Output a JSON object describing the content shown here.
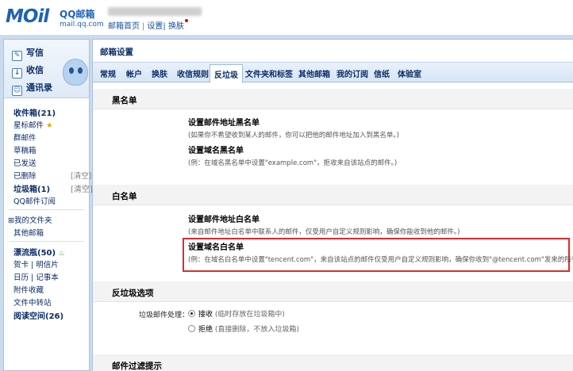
{
  "header": {
    "logo_mark": "MOil",
    "logo_qq": "QQ邮箱",
    "logo_domain": "mail.qq.com",
    "links": [
      "邮箱首页",
      "设置",
      "换肤"
    ],
    "link_sep": "|"
  },
  "sidebar": {
    "actions": [
      {
        "label": "写信",
        "icon": "pencil-icon"
      },
      {
        "label": "收信",
        "icon": "inbox-download-icon"
      },
      {
        "label": "通讯录",
        "icon": "contacts-icon"
      }
    ],
    "folders": {
      "inbox": "收件箱(21)",
      "starred": "星标邮件",
      "groups": "群邮件",
      "drafts": "草稿箱",
      "sent": "已发送",
      "deleted": "已删除",
      "deleted_extra": "[清空]",
      "spam": "垃圾箱(1)",
      "spam_extra": "[清空]",
      "qq_subscribe": "QQ邮件订阅",
      "my_folders": "⊞我的文件夹",
      "other_mail": "其他邮箱",
      "drift_bottle": "漂流瓶(50)",
      "cards": "贺卡",
      "postcard": "明信片",
      "calendar": "日历",
      "notes": "记事本",
      "attachments": "附件收藏",
      "file_transfer": "文件中转站",
      "reading": "阅读空间(26)",
      "item_sep": "|"
    }
  },
  "main": {
    "title": "邮箱设置",
    "tabs": [
      "常规",
      "帐户",
      "换肤",
      "收信规则",
      "反垃圾",
      "文件夹和标签",
      "其他邮箱",
      "我的订阅",
      "信纸",
      "体验室"
    ],
    "active_tab": "反垃圾",
    "blacklist": {
      "heading": "黑名单",
      "addr_title": "设置邮件地址黑名单",
      "addr_desc": "(如果你不希望收到某人的邮件，你可以把他的邮件地址加入到黑名单。)",
      "domain_title": "设置域名黑名单",
      "domain_desc": "(例：在域名黑名单中设置\"example.com\"，拒收来自该站点的邮件。)"
    },
    "whitelist": {
      "heading": "白名单",
      "addr_title": "设置邮件地址白名单",
      "addr_desc": "(来自邮件地址白名单中联系人的邮件，仅受用户自定义规则影响，确保你能收到他的邮件。)",
      "domain_title": "设置域名白名单",
      "domain_desc": "(例：在域名白名单中设置\"tencent.com\"，来自该站点的邮件仅受用户自定义规则影响，确保你收到\"@tencent.com\"发来的所有邮件。)"
    },
    "antispam": {
      "heading": "反垃圾选项",
      "label": "垃圾邮件处理：",
      "options": [
        {
          "label": "接收",
          "note": "(临时存放在垃圾箱中)",
          "selected": true
        },
        {
          "label": "拒绝",
          "note": "(直接删除，不放入垃圾箱)",
          "selected": false
        }
      ]
    },
    "filter_tip": {
      "heading": "邮件过滤提示"
    }
  }
}
